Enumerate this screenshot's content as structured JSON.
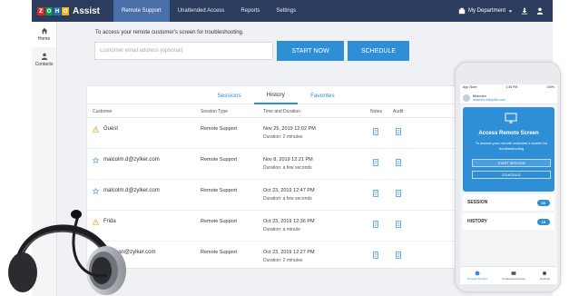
{
  "app": {
    "logo_letters": [
      "Z",
      "O",
      "H",
      "O"
    ],
    "logo_word": "Assist"
  },
  "nav": {
    "items": [
      "Remote Support",
      "Unattended Access",
      "Reports",
      "Settings"
    ],
    "active": "Remote Support"
  },
  "topright": {
    "department": "My Department"
  },
  "sidebar": {
    "items": [
      {
        "label": "Home",
        "icon": "home-icon"
      },
      {
        "label": "Contacts",
        "icon": "contacts-icon"
      }
    ]
  },
  "main": {
    "prompt": "To access your remote customer's screen for troubleshooting.",
    "email_placeholder": "Customer email address (optional)",
    "start_label": "START NOW",
    "schedule_label": "SCHEDULE"
  },
  "sessions": {
    "tabs": [
      "Sessions",
      "History",
      "Favorites"
    ],
    "active_tab": "History",
    "columns": [
      "Customer",
      "Session Type",
      "Time and Duration",
      "Notes",
      "Audit"
    ],
    "rows": [
      {
        "customer": "Guest",
        "icon": "warning-icon",
        "type": "Remote Support",
        "time": "Nov 25, 2019 12:02 PM",
        "duration": "Duration: 2 minutes"
      },
      {
        "customer": "malcolm.d@zylker.com",
        "icon": "star-icon",
        "type": "Remote Support",
        "time": "Nov 8, 2019 12:21 PM",
        "duration": "Duration: a few seconds"
      },
      {
        "customer": "malcolm.d@zylker.com",
        "icon": "star-icon",
        "type": "Remote Support",
        "time": "Oct 23, 2019 12:47 PM",
        "duration": "Duration: a few seconds"
      },
      {
        "customer": "Frida",
        "icon": "warning-icon",
        "type": "Remote Support",
        "time": "Oct 23, 2019 12:36 PM",
        "duration": "Duration: a minute"
      },
      {
        "customer": "jonathan@zylker.com",
        "icon": "star-icon",
        "type": "Remote Support",
        "time": "Oct 23, 2019 12:27 PM",
        "duration": "Duration: 2 minutes"
      }
    ]
  },
  "phone": {
    "status_left": "App Store",
    "status_time": "1:45 PM",
    "status_right": "100%",
    "user_name": "Malcolm",
    "user_email": "malcolm.d@zylker.com",
    "card_title": "Access Remote Screen",
    "card_sub": "To access your remote customer's screen for troubleshooting",
    "start_label": "START SESSION",
    "schedule_label": "SCHEDULE",
    "session_label": "SESSION",
    "session_count": "00",
    "history_label": "HISTORY",
    "history_count": "15",
    "tabs": [
      "Remote Support",
      "Unattended Access",
      "Settings"
    ]
  },
  "colors": {
    "topbar": "#2b3c5e",
    "accent": "#2e8ed6",
    "nav_active": "#4a6fa8"
  }
}
